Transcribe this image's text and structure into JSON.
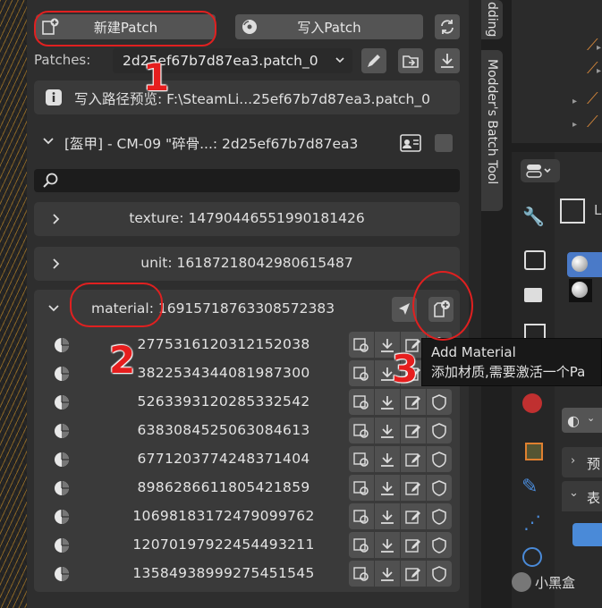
{
  "toolbar": {
    "new_patch_label": "新建Patch",
    "write_patch_label": "写入Patch"
  },
  "patches": {
    "label": "Patches:",
    "selected": "2d25ef67b7d87ea3.patch_0"
  },
  "path_preview": "写入路径预览: F:\\SteamLi...25ef67b7d87ea3.patch_0",
  "entry": {
    "title": "[盔甲] - CM-09 \"碎骨...: 2d25ef67b7d87ea3"
  },
  "search": {
    "placeholder": "",
    "value": ""
  },
  "sections": {
    "texture": "texture: 14790446551990181426",
    "unit": "unit: 16187218042980615487",
    "material": "material: 16915718763308572383"
  },
  "materials": [
    "2775316120312152038",
    "3822534344081987300",
    "5263393120285332542",
    "6383084525063084613",
    "6771203774248371404",
    "8986286611805421859",
    "10698183172479099762",
    "12070197922454493211",
    "13584938999275451545"
  ],
  "tooltip": {
    "title": "Add Material",
    "desc": "添加材质,需要激活一个Pa"
  },
  "side_tabs": {
    "top": "dding",
    "batch": "Modder's Batch Tool"
  },
  "right_panel": {
    "l_label": "L",
    "item1": "预",
    "item2": "表"
  },
  "annotations": {
    "n1": "1",
    "n2": "2",
    "n3": "3"
  },
  "watermark": "小黑盒",
  "colors": {
    "panel_bg": "#2e2e2e",
    "button_bg": "#545454",
    "annotation_red": "#e02020",
    "accent_blue": "#4a8ad8"
  }
}
